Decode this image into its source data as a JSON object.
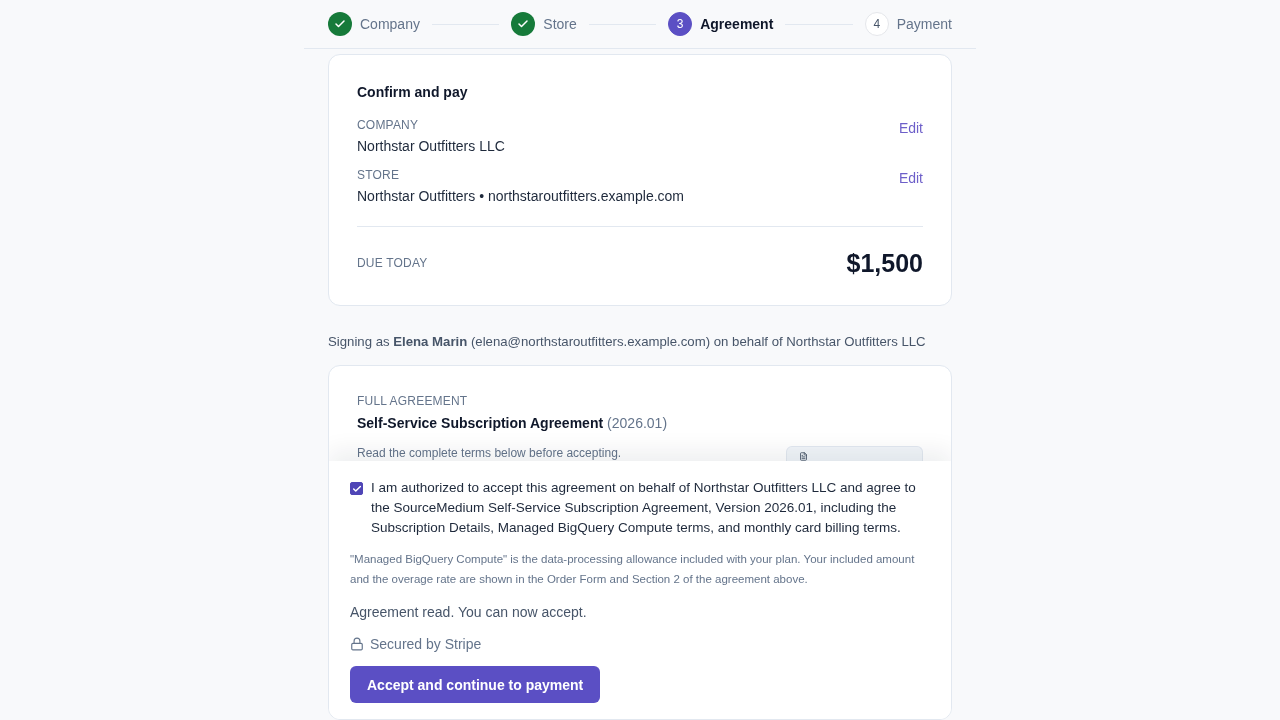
{
  "stepper": {
    "steps": [
      {
        "label": "Company",
        "kind": "complete"
      },
      {
        "label": "Store",
        "kind": "complete"
      },
      {
        "number": "3",
        "label": "Agreement",
        "kind": "current"
      },
      {
        "number": "4",
        "label": "Payment",
        "kind": "upcoming"
      }
    ]
  },
  "summary": {
    "title": "Confirm and pay",
    "rows": [
      {
        "label": "COMPANY",
        "value": "Northstar Outfitters LLC",
        "action": "Edit"
      },
      {
        "label": "STORE",
        "value": "Northstar Outfitters • northstaroutfitters.example.com",
        "action": "Edit"
      }
    ],
    "due": {
      "label": "DUE TODAY",
      "amount": "$1,500"
    }
  },
  "signing_note": "Signing as **Elena Marin** (elena@northstaroutfitters.example.com) on behalf of Northstar Outfitters LLC",
  "agreement": {
    "eyebrow": "FULL AGREEMENT",
    "title": "Self-Service Subscription Agreement",
    "version": "(2026.01)",
    "hint": "Read the complete terms below before accepting."
  },
  "accept_panel": {
    "consent": {
      "checked": true,
      "text": "I am authorized to accept this agreement on behalf of Northstar Outfitters LLC and agree to the SourceMedium Self-Service Subscription Agreement, Version 2026.01, including the Subscription Details, Managed BigQuery Compute terms, and monthly card billing terms."
    },
    "note": "\"Managed BigQuery Compute\" is the data-processing allowance included with your plan. Your included amount and the overage rate are shown in the Order Form and Section 2 of the agreement above.",
    "status": "Agreement read. You can now accept.",
    "security": "Secured by Stripe",
    "submit_button": "Accept and continue to payment"
  }
}
